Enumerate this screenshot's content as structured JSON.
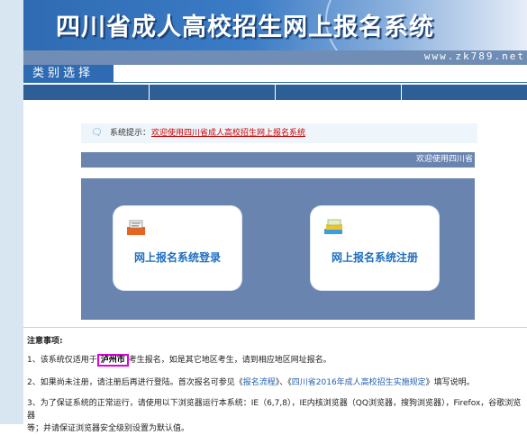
{
  "header": {
    "title": "四川省成人高校招生网上报名系统",
    "url": "www.zk789.net"
  },
  "category": {
    "label": "类别选择"
  },
  "notice": {
    "label": "系统提示：",
    "message": "欢迎使用四川省成人高校招生网上报名系统"
  },
  "welcome": {
    "text": "欢迎使用四川省"
  },
  "buttons": {
    "login": "网上报名系统登录",
    "register": "网上报名系统注册"
  },
  "notes": {
    "title": "注意事项:",
    "item1_pre": "1、该系统仅适用于",
    "item1_city": "泸州市",
    "item1_post": "考生报名，如是其它地区考生，请到相应地区网址报名。",
    "item2_pre": "2、如果尚未注册，请注册后再进行登陆。首次报名可参见《",
    "item2_link1": "报名流程",
    "item2_mid": "》、《",
    "item2_link2": "四川省2016年成人高校招生实施规定",
    "item2_post": "》填写说明。",
    "item3_line1": "3、为了保证系统的正常运行，请使用以下浏览器运行本系统：IE（6,7,8），IE内核浏览器（QQ浏览器，搜狗浏览器），Firefox，谷歌浏览器",
    "item3_line2": "等；并请保证浏览器安全级别设置为默认值。"
  },
  "colors": {
    "header_blue": "#2f6bb2",
    "panel": "#6a84b0",
    "notice_red": "#cc0000",
    "highlight": "#e000e0"
  }
}
